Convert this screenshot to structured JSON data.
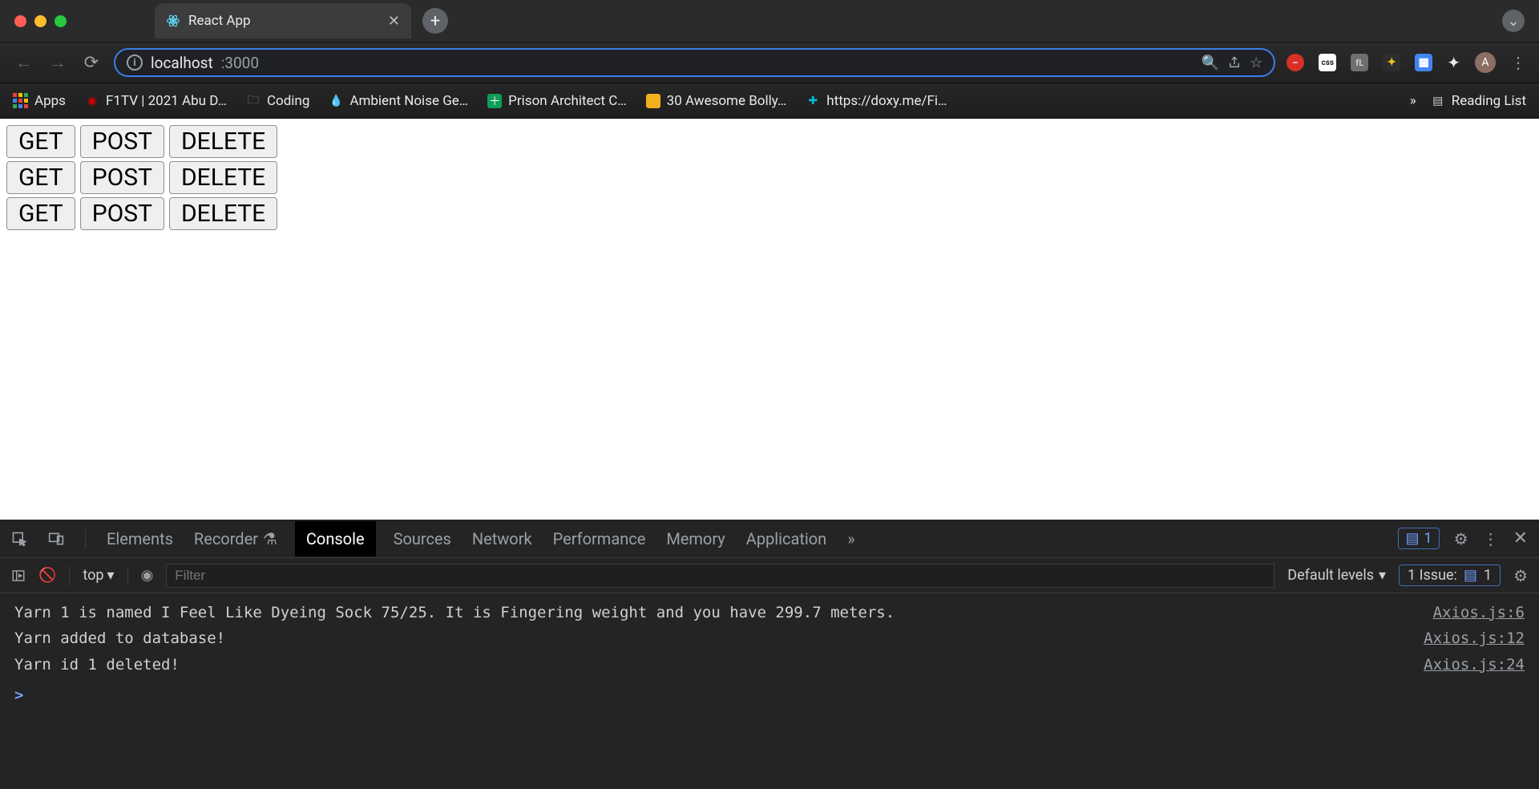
{
  "window": {
    "tab_title": "React App",
    "expand_tooltip": "Expand"
  },
  "nav": {
    "url_host": "localhost",
    "url_port": ":3000"
  },
  "bookmarks": {
    "apps": "Apps",
    "items": [
      {
        "label": "F1TV | 2021 Abu D…",
        "icon_color": "#d40000"
      },
      {
        "label": "Coding",
        "icon_color": "#9aa0a6"
      },
      {
        "label": "Ambient Noise Ge…",
        "icon_color": "#4aa3ff"
      },
      {
        "label": "Prison Architect C…",
        "icon_color": "#0f9d58"
      },
      {
        "label": "30 Awesome Bolly…",
        "icon_color": "#f2b01e"
      },
      {
        "label": "https://doxy.me/Fi…",
        "icon_color": "#00bcd4"
      }
    ],
    "overflow": "»",
    "reading_list": "Reading List"
  },
  "page": {
    "rows": [
      {
        "buttons": [
          "GET",
          "POST",
          "DELETE"
        ]
      },
      {
        "buttons": [
          "GET",
          "POST",
          "DELETE"
        ]
      },
      {
        "buttons": [
          "GET",
          "POST",
          "DELETE"
        ]
      }
    ]
  },
  "ext": {
    "avatar_initial": "A"
  },
  "devtools": {
    "tabs": [
      "Elements",
      "Recorder",
      "Console",
      "Sources",
      "Network",
      "Performance",
      "Memory",
      "Application"
    ],
    "active_tab": "Console",
    "more": "»",
    "msg_count": "1",
    "context": "top",
    "filter_placeholder": "Filter",
    "levels": "Default levels",
    "issues_label": "1 Issue:",
    "issues_count": "1",
    "logs": [
      {
        "msg": "Yarn 1 is named I Feel Like Dyeing Sock 75/25. It is Fingering weight and you have 299.7 meters.",
        "src": "Axios.js:6"
      },
      {
        "msg": "Yarn added to database!",
        "src": "Axios.js:12"
      },
      {
        "msg": "Yarn id 1 deleted!",
        "src": "Axios.js:24"
      }
    ],
    "prompt": ">"
  }
}
